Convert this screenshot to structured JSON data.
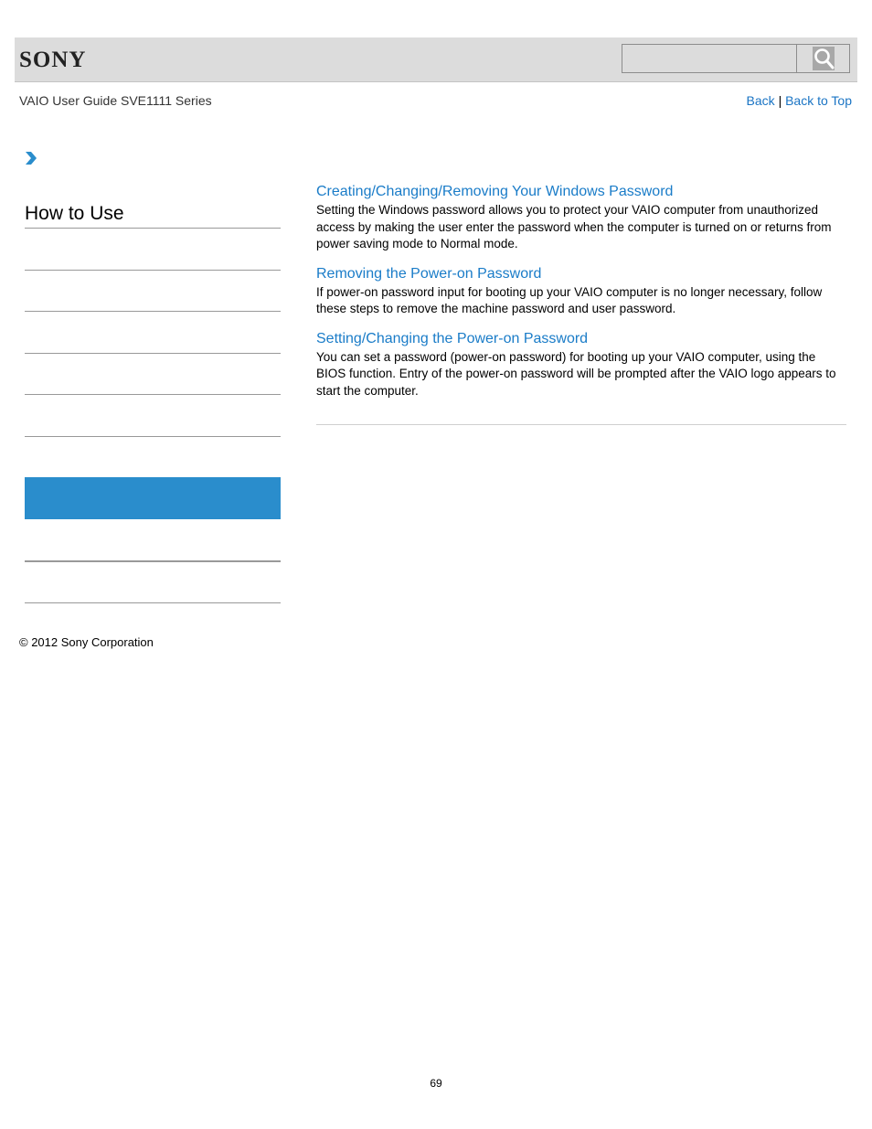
{
  "header": {
    "logo": "SONY",
    "search": {
      "placeholder": "",
      "value": "",
      "button_icon": "search-icon"
    }
  },
  "subheader": {
    "guide_title": "VAIO User Guide SVE1111 Series",
    "back_label": "Back",
    "separator": "|",
    "back_to_top_label": "Back to Top"
  },
  "breadcrumb": {
    "icon": "chevron-right-icon"
  },
  "sidebar": {
    "title": "How to Use",
    "items": [
      {
        "label": "",
        "active": false
      },
      {
        "label": "",
        "active": false
      },
      {
        "label": "",
        "active": false
      },
      {
        "label": "",
        "active": false
      },
      {
        "label": "",
        "active": false
      },
      {
        "label": "",
        "active": false
      },
      {
        "label": "",
        "active": true
      },
      {
        "label": "",
        "active": false
      },
      {
        "label": "",
        "active": false
      }
    ],
    "active_color": "#2a8dcc"
  },
  "main": {
    "sections": [
      {
        "title": "Creating/Changing/Removing Your Windows Password",
        "body": "Setting the Windows password allows you to protect your VAIO computer from unauthorized access by making the user enter the password when the computer is turned on or returns from power saving mode to Normal mode."
      },
      {
        "title": "Removing the Power-on Password",
        "body": "If power-on password input for booting up your VAIO computer is no longer necessary, follow these steps to remove the machine password and user password."
      },
      {
        "title": "Setting/Changing the Power-on Password",
        "body": "You can set a password (power-on password) for booting up your VAIO computer, using the BIOS function. Entry of the power-on password will be prompted after the VAIO logo appears to start the computer."
      }
    ],
    "link_color": "#1a7cc8"
  },
  "footer": {
    "copyright": "© 2012 Sony Corporation",
    "page_number": "69"
  }
}
